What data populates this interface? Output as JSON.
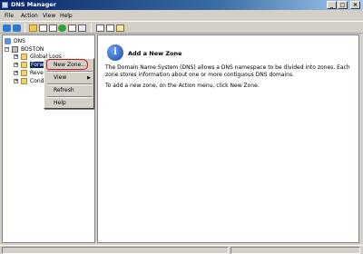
{
  "window": {
    "title": "DNS Manager",
    "min_glyph": "_",
    "max_glyph": "□",
    "close_glyph": "×"
  },
  "menubar": {
    "items": [
      "File",
      "Action",
      "View",
      "Help"
    ]
  },
  "toolbar": {
    "icons": [
      "back-icon",
      "forward-icon",
      "up-folder-icon",
      "show-hide-tree-icon",
      "properties-icon",
      "refresh-icon",
      "export-icon",
      "help-icon",
      "server-icon",
      "record-icon",
      "new-zone-icon"
    ]
  },
  "tree": {
    "root": "DNS",
    "server": "BOSTON",
    "items": [
      "Global Logs",
      "Forward Lookup Zones",
      "Reverse Lookup Zones",
      "Conditional Forwarders"
    ],
    "visible_labels": [
      "Global Logs",
      "Forwa",
      "Rever",
      "Condi"
    ],
    "expand_glyph": "+",
    "collapse_glyph": "−"
  },
  "context_menu": {
    "items": [
      {
        "label": "New Zone...",
        "highlighted": true
      },
      {
        "label": "View",
        "submenu": true
      },
      {
        "label": "Refresh"
      },
      {
        "label": "Help"
      }
    ],
    "submenu_glyph": "▶"
  },
  "content": {
    "heading": "Add a New Zone",
    "paragraph1": "The Domain Name System (DNS) allows a DNS namespace to be divided into zones. Each zone stores information about one or more contiguous DNS domains.",
    "paragraph2": "To add a new zone, on the Action menu, click New Zone.",
    "icon_glyph": "i"
  },
  "colors": {
    "titlebar_start": "#0a246a",
    "selection": "#0a246a",
    "annotation_mark": "#d01010"
  }
}
